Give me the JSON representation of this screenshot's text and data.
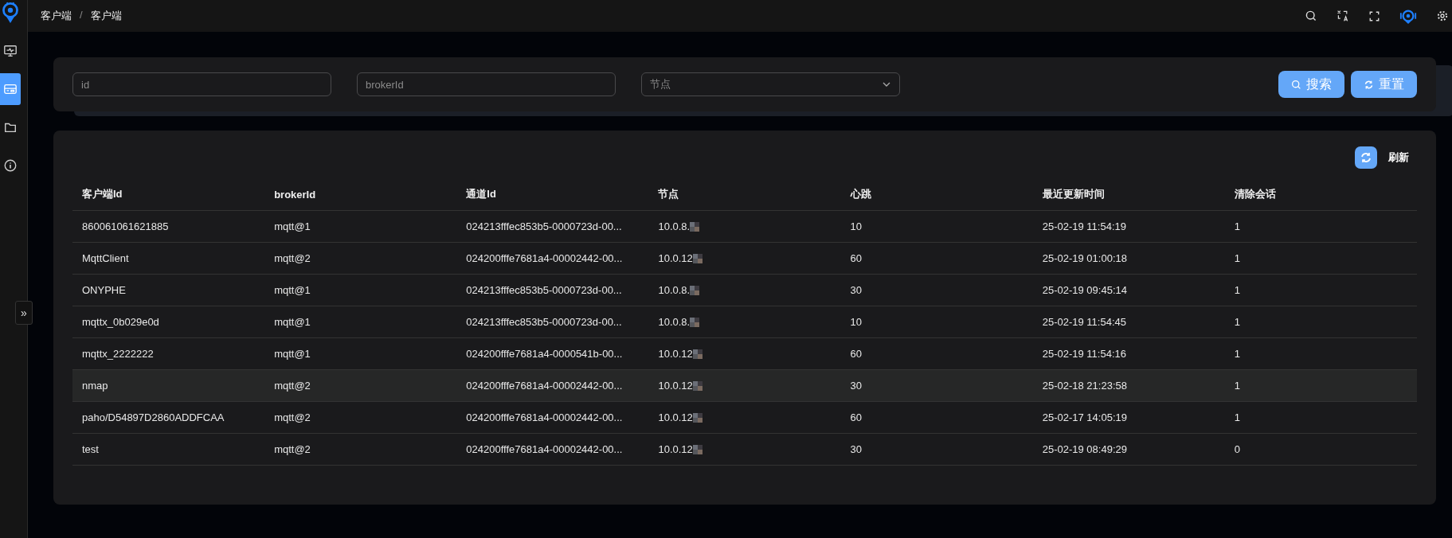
{
  "sidebar": {
    "items": [
      {
        "kind": "monitor",
        "selected": false
      },
      {
        "kind": "card",
        "selected": true
      },
      {
        "kind": "folder",
        "selected": false
      },
      {
        "kind": "info",
        "selected": false
      }
    ],
    "collapse_toggle": "»"
  },
  "breadcrumb": [
    "客户端",
    "客户端"
  ],
  "breadcrumb_separator": "/",
  "filters": {
    "id": {
      "placeholder": "id"
    },
    "broker": {
      "placeholder": "brokerId"
    },
    "node": {
      "placeholder": "节点"
    }
  },
  "buttons": {
    "search": "搜索",
    "reset": "重置",
    "refresh": "刷新"
  },
  "table": {
    "columns": [
      "客户端Id",
      "brokerId",
      "通道Id",
      "节点",
      "心跳",
      "最近更新时间",
      "清除会话"
    ],
    "rows": [
      {
        "cells": [
          "860061061621885",
          "mqtt@1",
          "024213fffec853b5-0000723d-00...",
          "10.0.8.",
          "10",
          "25-02-19 11:54:19",
          "1"
        ],
        "highlighted": false
      },
      {
        "cells": [
          "MqttClient",
          "mqtt@2",
          "024200fffe7681a4-00002442-00...",
          "10.0.12",
          "60",
          "25-02-19 01:00:18",
          "1"
        ],
        "highlighted": false
      },
      {
        "cells": [
          "ONYPHE",
          "mqtt@1",
          "024213fffec853b5-0000723d-00...",
          "10.0.8.",
          "30",
          "25-02-19 09:45:14",
          "1"
        ],
        "highlighted": false
      },
      {
        "cells": [
          "mqttx_0b029e0d",
          "mqtt@1",
          "024213fffec853b5-0000723d-00...",
          "10.0.8.",
          "10",
          "25-02-19 11:54:45",
          "1"
        ],
        "highlighted": false
      },
      {
        "cells": [
          "mqttx_2222222",
          "mqtt@1",
          "024200fffe7681a4-0000541b-00...",
          "10.0.12",
          "60",
          "25-02-19 11:54:16",
          "1"
        ],
        "highlighted": false
      },
      {
        "cells": [
          "nmap",
          "mqtt@2",
          "024200fffe7681a4-00002442-00...",
          "10.0.12",
          "30",
          "25-02-18 21:23:58",
          "1"
        ],
        "highlighted": true
      },
      {
        "cells": [
          "paho/D54897D2860ADDFCAA",
          "mqtt@2",
          "024200fffe7681a4-00002442-00...",
          "10.0.12",
          "60",
          "25-02-17 14:05:19",
          "1"
        ],
        "highlighted": false
      },
      {
        "cells": [
          "test",
          "mqtt@2",
          "024200fffe7681a4-00002442-00...",
          "10.0.12",
          "30",
          "25-02-19 08:49:29",
          "0"
        ],
        "highlighted": false
      }
    ]
  }
}
